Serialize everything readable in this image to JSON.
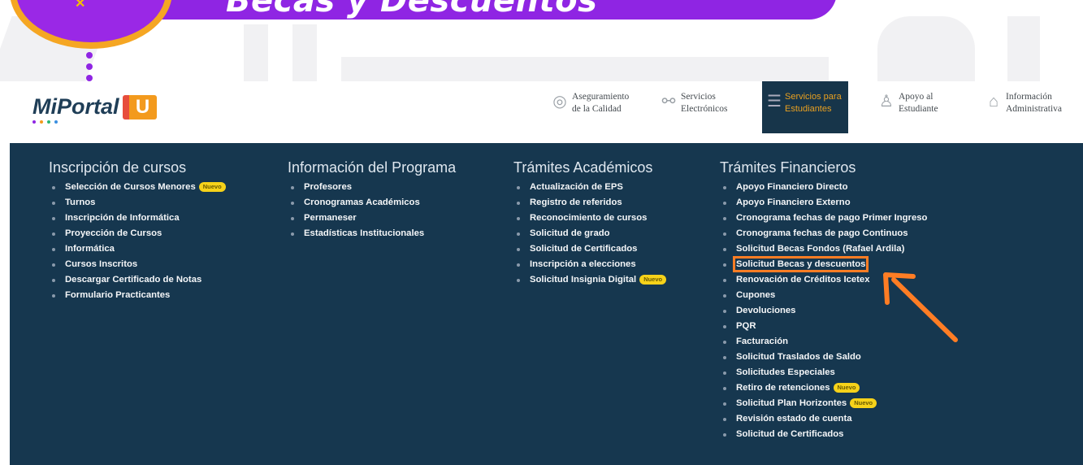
{
  "banner": {
    "title": "Becas y Descuentos"
  },
  "logo": {
    "text": "MiPortal",
    "mark": "U"
  },
  "nav": [
    {
      "label": "Aseguramiento de la Calidad",
      "icon": "seal-icon"
    },
    {
      "label": "Servicios Electrónicos",
      "icon": "network-icon"
    },
    {
      "label": "Servicios para Estudiantes",
      "icon": "student-icon",
      "active": true
    },
    {
      "label": "Apoyo al Estudiante",
      "icon": "person-icon"
    },
    {
      "label": "Información Administrativa",
      "icon": "building-icon"
    }
  ],
  "badge_label": "Nuevo",
  "columns": [
    {
      "title": "Inscripción de cursos",
      "items": [
        {
          "label": "Selección de Cursos Menores",
          "badge": true
        },
        {
          "label": "Turnos"
        },
        {
          "label": "Inscripción de Informática"
        },
        {
          "label": "Proyección de Cursos"
        },
        {
          "label": "Informática"
        },
        {
          "label": "Cursos Inscritos"
        },
        {
          "label": "Descargar Certificado de Notas"
        },
        {
          "label": "Formulario Practicantes"
        }
      ]
    },
    {
      "title": "Información del Programa",
      "items": [
        {
          "label": "Profesores"
        },
        {
          "label": "Cronogramas Académicos"
        },
        {
          "label": "Permaneser"
        },
        {
          "label": "Estadísticas Institucionales"
        }
      ]
    },
    {
      "title": "Trámites Académicos",
      "items": [
        {
          "label": "Actualización de EPS"
        },
        {
          "label": "Registro de referidos"
        },
        {
          "label": "Reconocimiento de cursos"
        },
        {
          "label": "Solicitud de grado"
        },
        {
          "label": "Solicitud de Certificados"
        },
        {
          "label": "Inscripción a elecciones"
        },
        {
          "label": "Solicitud Insignia Digital",
          "badge": true
        }
      ]
    },
    {
      "title": "Trámites Financieros",
      "items": [
        {
          "label": "Apoyo Financiero Directo"
        },
        {
          "label": "Apoyo Financiero Externo"
        },
        {
          "label": "Cronograma fechas de pago Primer Ingreso"
        },
        {
          "label": "Cronograma fechas de pago Continuos"
        },
        {
          "label": "Solicitud Becas Fondos (Rafael Ardila)"
        },
        {
          "label": "Solicitud Becas y descuentos",
          "highlighted": true
        },
        {
          "label": "Renovación de Créditos Icetex"
        },
        {
          "label": "Cupones"
        },
        {
          "label": "Devoluciones"
        },
        {
          "label": "PQR"
        },
        {
          "label": "Facturación"
        },
        {
          "label": "Solicitud Traslados de Saldo"
        },
        {
          "label": "Solicitudes Especiales"
        },
        {
          "label": "Retiro de retenciones",
          "badge": true
        },
        {
          "label": "Solicitud Plan Horizontes",
          "badge": true
        },
        {
          "label": "Revisión estado de cuenta"
        },
        {
          "label": "Solicitud de Certificados"
        }
      ]
    }
  ],
  "colors": {
    "panel": "#16374f",
    "banner": "#8f25e3",
    "highlight": "#ff7d24",
    "badge": "#f6d21a",
    "active_tab_text": "#e9a020"
  }
}
